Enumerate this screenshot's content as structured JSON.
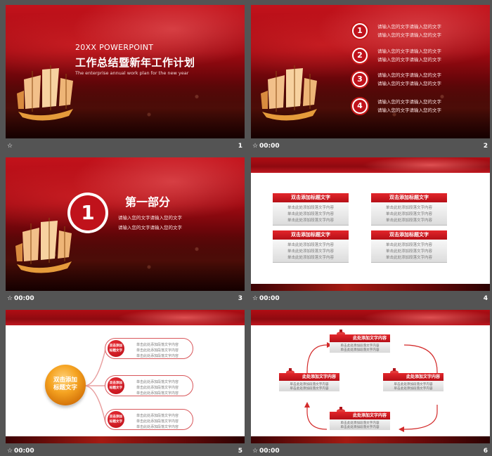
{
  "slides": [
    {
      "number": "1",
      "time": "",
      "star": "☆",
      "title_en": "20XX POWERPOINT",
      "title_cn": "工作总结暨新年工作计划",
      "subtitle": "The enterprise annual work plan for the new year"
    },
    {
      "number": "2",
      "time": "00:00",
      "star": "☆",
      "items": [
        {
          "num": "1",
          "line1": "请输入您的文字请输入您的文字",
          "line2": "请输入您的文字请输入您的文字"
        },
        {
          "num": "2",
          "line1": "请输入您的文字请输入您的文字",
          "line2": "请输入您的文字请输入您的文字"
        },
        {
          "num": "3",
          "line1": "请输入您的文字请输入您的文字",
          "line2": "请输入您的文字请输入您的文字"
        },
        {
          "num": "4",
          "line1": "请输入您的文字请输入您的文字",
          "line2": "请输入您的文字请输入您的文字"
        }
      ]
    },
    {
      "number": "3",
      "time": "00:00",
      "star": "☆",
      "big_num": "1",
      "section_title": "第一部分",
      "line1": "请输入您的文字请输入您的文字",
      "line2": "请输入您的文字请输入您的文字"
    },
    {
      "number": "4",
      "time": "00:00",
      "star": "☆",
      "boxes": [
        {
          "title": "双击添加标题文字",
          "lines": [
            "单击此处添加段落文字内容",
            "单击此处添加段落文字内容",
            "单击此处添加段落文字内容"
          ]
        },
        {
          "title": "双击添加标题文字",
          "lines": [
            "单击此处添加段落文字内容",
            "单击此处添加段落文字内容",
            "单击此处添加段落文字内容"
          ]
        },
        {
          "title": "双击添加标题文字",
          "lines": [
            "单击此处添加段落文字内容",
            "单击此处添加段落文字内容",
            "单击此处添加段落文字内容"
          ]
        },
        {
          "title": "双击添加标题文字",
          "lines": [
            "单击此处添加段落文字内容",
            "单击此处添加段落文字内容",
            "单击此处添加段落文字内容"
          ]
        }
      ]
    },
    {
      "number": "5",
      "time": "00:00",
      "star": "☆",
      "center_line1": "双击添加",
      "center_line2": "标题文字",
      "pills": [
        {
          "t1": "双击添加",
          "t2": "标题文字",
          "lines": [
            "单击此处添加段落文字内容",
            "单击此处添加段落文字内容",
            "单击此处添加段落文字内容"
          ]
        },
        {
          "t1": "双击添加",
          "t2": "标题文字",
          "lines": [
            "单击此处添加段落文字内容",
            "单击此处添加段落文字内容",
            "单击此处添加段落文字内容"
          ]
        },
        {
          "t1": "双击添加",
          "t2": "标题文字",
          "lines": [
            "单击此处添加段落文字内容",
            "单击此处添加段落文字内容",
            "单击此处添加段落文字内容"
          ]
        }
      ]
    },
    {
      "number": "6",
      "time": "00:00",
      "star": "☆",
      "nodes": [
        {
          "title": "此处添加文字内容",
          "lines": [
            "单击此处添加段落文字内容",
            "单击此处添加段落文字内容"
          ]
        },
        {
          "title": "此处添加文字内容",
          "lines": [
            "单击此处添加段落文字内容",
            "单击此处添加段落文字内容"
          ]
        },
        {
          "title": "此处添加文字内容",
          "lines": [
            "单击此处添加段落文字内容",
            "单击此处添加段落文字内容"
          ]
        },
        {
          "title": "此处添加文字内容",
          "lines": [
            "单击此处添加段落文字内容",
            "单击此处添加段落文字内容"
          ]
        }
      ]
    }
  ],
  "colors": {
    "panel_bg": "#545454",
    "brand_red": "#c0121b",
    "accent_orange": "#f5a321"
  }
}
